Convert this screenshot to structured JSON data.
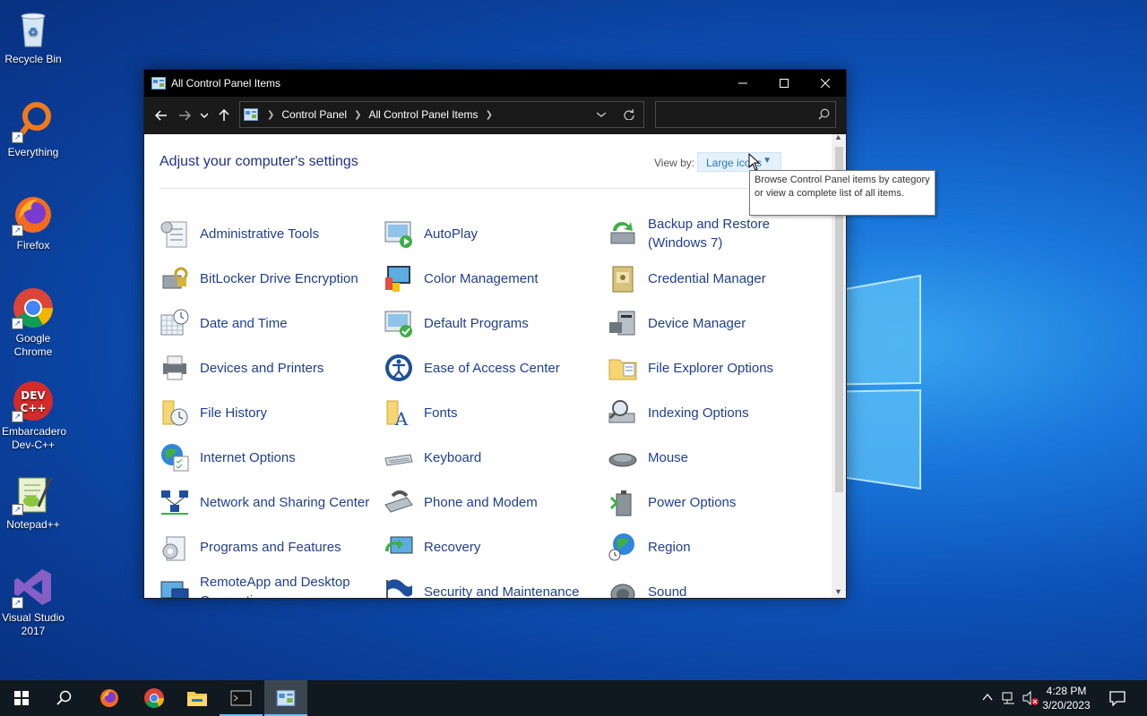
{
  "desktop": {
    "icons": [
      {
        "name": "recycle-bin",
        "label": "Recycle Bin"
      },
      {
        "name": "everything",
        "label": "Everything"
      },
      {
        "name": "firefox",
        "label": "Firefox"
      },
      {
        "name": "google-chrome",
        "label": "Google Chrome"
      },
      {
        "name": "embarcadero-devcpp",
        "label": "Embarcadero Dev-C++"
      },
      {
        "name": "notepadpp",
        "label": "Notepad++"
      },
      {
        "name": "visual-studio",
        "label": "Visual Studio 2017"
      }
    ]
  },
  "window": {
    "title": "All Control Panel Items",
    "breadcrumb": [
      "Control Panel",
      "All Control Panel Items"
    ],
    "search_placeholder": "",
    "heading": "Adjust your computer's settings",
    "view_by_label": "View by:",
    "view_by_value": "Large icons",
    "tooltip": "Browse Control Panel items by category or view a complete list of all items.",
    "items": [
      [
        "Administrative Tools",
        "AutoPlay",
        "Backup and Restore (Windows 7)"
      ],
      [
        "BitLocker Drive Encryption",
        "Color Management",
        "Credential Manager"
      ],
      [
        "Date and Time",
        "Default Programs",
        "Device Manager"
      ],
      [
        "Devices and Printers",
        "Ease of Access Center",
        "File Explorer Options"
      ],
      [
        "File History",
        "Fonts",
        "Indexing Options"
      ],
      [
        "Internet Options",
        "Keyboard",
        "Mouse"
      ],
      [
        "Network and Sharing Center",
        "Phone and Modem",
        "Power Options"
      ],
      [
        "Programs and Features",
        "Recovery",
        "Region"
      ],
      [
        "RemoteApp and Desktop Connections",
        "Security and Maintenance",
        "Sound"
      ]
    ]
  },
  "taskbar": {
    "time": "4:28 PM",
    "date": "3/20/2023"
  },
  "colors": {
    "accent": "#2a76c5",
    "link": "#1f3f8c",
    "taskbar": "#101820"
  }
}
